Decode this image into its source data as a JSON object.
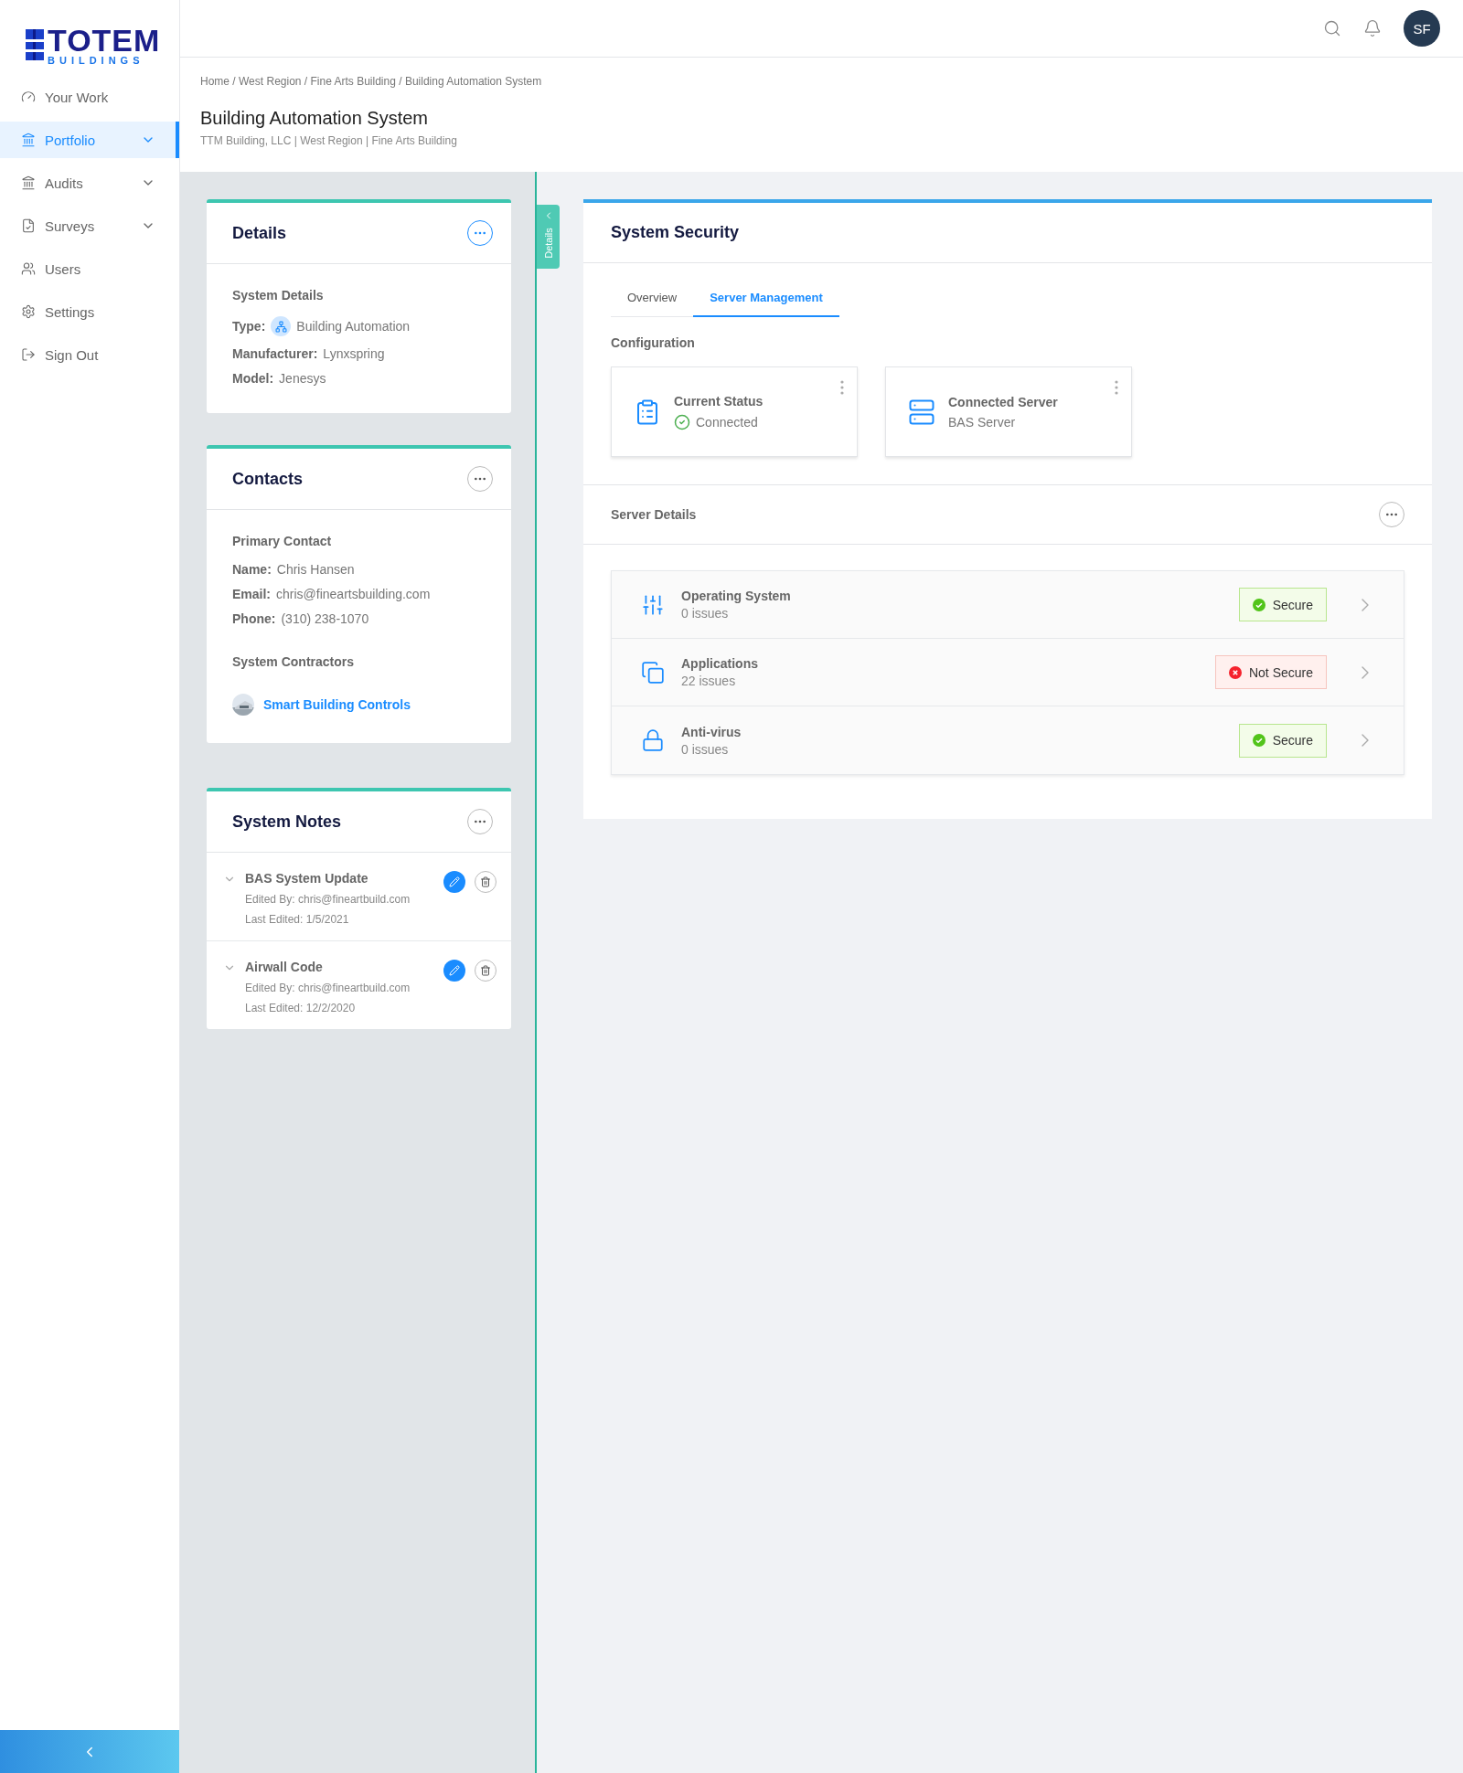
{
  "logo": {
    "wordmark": "TOTEM",
    "subtitle": "BUILDINGS"
  },
  "nav": [
    {
      "label": "Your Work",
      "kind": "gauge",
      "selected": false,
      "has_menu": false
    },
    {
      "label": "Portfolio",
      "kind": "bank",
      "selected": true,
      "has_menu": true
    },
    {
      "label": "Audits",
      "kind": "bank",
      "selected": false,
      "has_menu": true
    },
    {
      "label": "Surveys",
      "kind": "survey",
      "selected": false,
      "has_menu": true
    },
    {
      "label": "Users",
      "kind": "users",
      "selected": false,
      "has_menu": false
    },
    {
      "label": "Settings",
      "kind": "gear",
      "selected": false,
      "has_menu": false
    },
    {
      "label": "Sign Out",
      "kind": "signout",
      "selected": false,
      "has_menu": false
    }
  ],
  "header": {
    "avatar": "SF"
  },
  "breadcrumb": "Home / West Region / Fine Arts Building / Building Automation System",
  "page": {
    "title": "Building Automation System",
    "subtitle": "TTM Building, LLC | West Region | Fine Arts Building"
  },
  "side_tab": {
    "label": "Details"
  },
  "details": {
    "title": "Details",
    "menu_active": true,
    "section": "System Details",
    "fields": [
      {
        "label": "Type:",
        "value": "Building Automation",
        "kind": "icon"
      },
      {
        "label": "Manufacturer:",
        "value": "Lynxspring",
        "kind": "text"
      },
      {
        "label": "Model:",
        "value": "Jenesys",
        "kind": "text"
      }
    ]
  },
  "contacts": {
    "title": "Contacts",
    "menu_active": false,
    "section": "Primary Contact",
    "fields": [
      {
        "label": "Name:",
        "value": "Chris Hansen"
      },
      {
        "label": "Email:",
        "value": "chris@fineartsbuilding.com"
      },
      {
        "label": "Phone:",
        "value": "(310) 238-1070"
      }
    ],
    "contractors_title": "System Contractors",
    "contractors": [
      {
        "name": "Smart Building Controls",
        "kind": "picture"
      }
    ]
  },
  "notes": {
    "title": "System Notes",
    "menu_active": false,
    "items": [
      {
        "title": "BAS System Update",
        "edited_by": "Edited By: chris@fineartbuild.com",
        "last_edited": "Last Edited: 1/5/2021"
      },
      {
        "title": "Airwall Code",
        "edited_by": "Edited By: chris@fineartbuild.com",
        "last_edited": "Last Edited: 12/2/2020"
      }
    ]
  },
  "security": {
    "title": "System Security",
    "tabs": [
      {
        "label": "Overview",
        "selected": false
      },
      {
        "label": "Server Management",
        "selected": true
      }
    ],
    "configuration_title": "Configuration",
    "config_cards": [
      {
        "kind": "status",
        "title": "Current Status",
        "value": "Connected"
      },
      {
        "kind": "server",
        "title": "Connected Server",
        "value": "BAS Server"
      }
    ],
    "server_details_title": "Server Details",
    "servers": [
      {
        "kind": "os",
        "name": "Operating System",
        "issues": "0 issues",
        "status": "Secure",
        "secure": true
      },
      {
        "kind": "apps",
        "name": "Applications",
        "issues": "22 issues",
        "status": "Not Secure",
        "secure": false
      },
      {
        "kind": "antivirus",
        "name": "Anti-virus",
        "issues": "0 issues",
        "status": "Secure",
        "secure": true
      }
    ]
  }
}
